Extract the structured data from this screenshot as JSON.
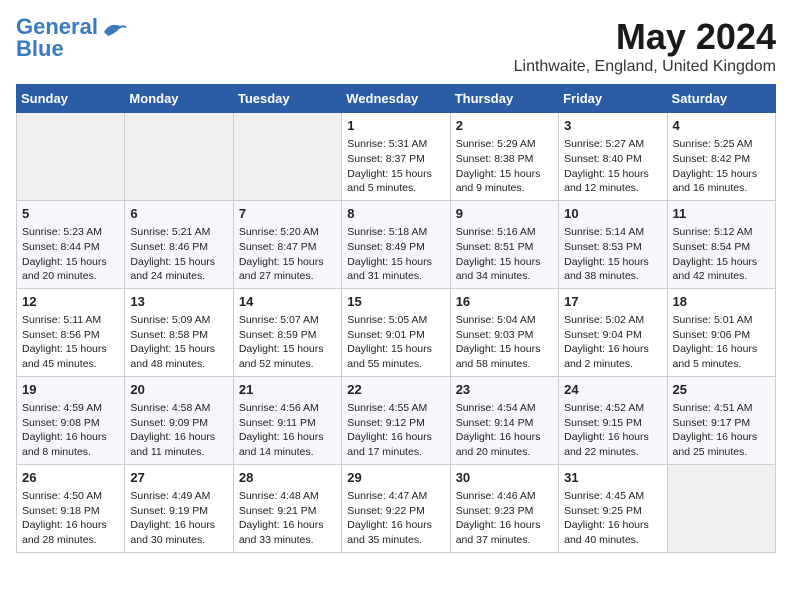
{
  "header": {
    "logo_general": "General",
    "logo_blue": "Blue",
    "month_year": "May 2024",
    "location": "Linthwaite, England, United Kingdom"
  },
  "weekdays": [
    "Sunday",
    "Monday",
    "Tuesday",
    "Wednesday",
    "Thursday",
    "Friday",
    "Saturday"
  ],
  "weeks": [
    [
      {
        "day": "",
        "info": ""
      },
      {
        "day": "",
        "info": ""
      },
      {
        "day": "",
        "info": ""
      },
      {
        "day": "1",
        "info": "Sunrise: 5:31 AM\nSunset: 8:37 PM\nDaylight: 15 hours\nand 5 minutes."
      },
      {
        "day": "2",
        "info": "Sunrise: 5:29 AM\nSunset: 8:38 PM\nDaylight: 15 hours\nand 9 minutes."
      },
      {
        "day": "3",
        "info": "Sunrise: 5:27 AM\nSunset: 8:40 PM\nDaylight: 15 hours\nand 12 minutes."
      },
      {
        "day": "4",
        "info": "Sunrise: 5:25 AM\nSunset: 8:42 PM\nDaylight: 15 hours\nand 16 minutes."
      }
    ],
    [
      {
        "day": "5",
        "info": "Sunrise: 5:23 AM\nSunset: 8:44 PM\nDaylight: 15 hours\nand 20 minutes."
      },
      {
        "day": "6",
        "info": "Sunrise: 5:21 AM\nSunset: 8:46 PM\nDaylight: 15 hours\nand 24 minutes."
      },
      {
        "day": "7",
        "info": "Sunrise: 5:20 AM\nSunset: 8:47 PM\nDaylight: 15 hours\nand 27 minutes."
      },
      {
        "day": "8",
        "info": "Sunrise: 5:18 AM\nSunset: 8:49 PM\nDaylight: 15 hours\nand 31 minutes."
      },
      {
        "day": "9",
        "info": "Sunrise: 5:16 AM\nSunset: 8:51 PM\nDaylight: 15 hours\nand 34 minutes."
      },
      {
        "day": "10",
        "info": "Sunrise: 5:14 AM\nSunset: 8:53 PM\nDaylight: 15 hours\nand 38 minutes."
      },
      {
        "day": "11",
        "info": "Sunrise: 5:12 AM\nSunset: 8:54 PM\nDaylight: 15 hours\nand 42 minutes."
      }
    ],
    [
      {
        "day": "12",
        "info": "Sunrise: 5:11 AM\nSunset: 8:56 PM\nDaylight: 15 hours\nand 45 minutes."
      },
      {
        "day": "13",
        "info": "Sunrise: 5:09 AM\nSunset: 8:58 PM\nDaylight: 15 hours\nand 48 minutes."
      },
      {
        "day": "14",
        "info": "Sunrise: 5:07 AM\nSunset: 8:59 PM\nDaylight: 15 hours\nand 52 minutes."
      },
      {
        "day": "15",
        "info": "Sunrise: 5:05 AM\nSunset: 9:01 PM\nDaylight: 15 hours\nand 55 minutes."
      },
      {
        "day": "16",
        "info": "Sunrise: 5:04 AM\nSunset: 9:03 PM\nDaylight: 15 hours\nand 58 minutes."
      },
      {
        "day": "17",
        "info": "Sunrise: 5:02 AM\nSunset: 9:04 PM\nDaylight: 16 hours\nand 2 minutes."
      },
      {
        "day": "18",
        "info": "Sunrise: 5:01 AM\nSunset: 9:06 PM\nDaylight: 16 hours\nand 5 minutes."
      }
    ],
    [
      {
        "day": "19",
        "info": "Sunrise: 4:59 AM\nSunset: 9:08 PM\nDaylight: 16 hours\nand 8 minutes."
      },
      {
        "day": "20",
        "info": "Sunrise: 4:58 AM\nSunset: 9:09 PM\nDaylight: 16 hours\nand 11 minutes."
      },
      {
        "day": "21",
        "info": "Sunrise: 4:56 AM\nSunset: 9:11 PM\nDaylight: 16 hours\nand 14 minutes."
      },
      {
        "day": "22",
        "info": "Sunrise: 4:55 AM\nSunset: 9:12 PM\nDaylight: 16 hours\nand 17 minutes."
      },
      {
        "day": "23",
        "info": "Sunrise: 4:54 AM\nSunset: 9:14 PM\nDaylight: 16 hours\nand 20 minutes."
      },
      {
        "day": "24",
        "info": "Sunrise: 4:52 AM\nSunset: 9:15 PM\nDaylight: 16 hours\nand 22 minutes."
      },
      {
        "day": "25",
        "info": "Sunrise: 4:51 AM\nSunset: 9:17 PM\nDaylight: 16 hours\nand 25 minutes."
      }
    ],
    [
      {
        "day": "26",
        "info": "Sunrise: 4:50 AM\nSunset: 9:18 PM\nDaylight: 16 hours\nand 28 minutes."
      },
      {
        "day": "27",
        "info": "Sunrise: 4:49 AM\nSunset: 9:19 PM\nDaylight: 16 hours\nand 30 minutes."
      },
      {
        "day": "28",
        "info": "Sunrise: 4:48 AM\nSunset: 9:21 PM\nDaylight: 16 hours\nand 33 minutes."
      },
      {
        "day": "29",
        "info": "Sunrise: 4:47 AM\nSunset: 9:22 PM\nDaylight: 16 hours\nand 35 minutes."
      },
      {
        "day": "30",
        "info": "Sunrise: 4:46 AM\nSunset: 9:23 PM\nDaylight: 16 hours\nand 37 minutes."
      },
      {
        "day": "31",
        "info": "Sunrise: 4:45 AM\nSunset: 9:25 PM\nDaylight: 16 hours\nand 40 minutes."
      },
      {
        "day": "",
        "info": ""
      }
    ]
  ]
}
